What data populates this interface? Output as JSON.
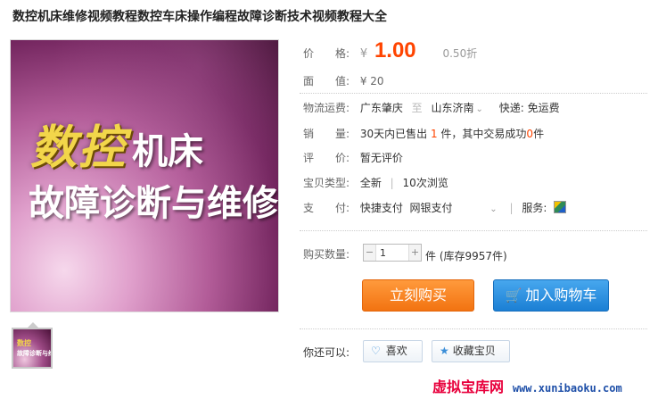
{
  "product": {
    "title": "数控机床维修视频教程数控车床操作编程故障诊断技术视频教程大全",
    "image_text_line1_gold": "数控",
    "image_text_line1_white": "机床",
    "image_text_line2": "故障诊断与维修"
  },
  "thumb": {
    "text_a": "数控",
    "text_b": "故障诊断与维修"
  },
  "price": {
    "label": "价　　格:",
    "symbol": "¥",
    "value": "1.00",
    "discount": "0.50折"
  },
  "face_value": {
    "label": "面　　值:",
    "value": "¥ 20"
  },
  "shipping": {
    "label": "物流运费:",
    "from": "广东肇庆",
    "sep": "至",
    "to": "山东济南",
    "express": "快递: 免运费"
  },
  "sales": {
    "label": "销　　量:",
    "prefix": "30天内已售出",
    "sold": "1",
    "mid": "件，其中交易成功",
    "success": "0",
    "suffix": "件"
  },
  "review": {
    "label": "评　　价:",
    "value": "暂无评价"
  },
  "item_type": {
    "label": "宝贝类型:",
    "condition": "全新",
    "views": "10次浏览"
  },
  "payment": {
    "label": "支　　付:",
    "methods": "快捷支付  网银支付",
    "service_label": "服务:"
  },
  "quantity": {
    "label": "购买数量:",
    "value": "1",
    "stock": "件 (库存9957件)"
  },
  "buttons": {
    "buy_now": "立刻购买",
    "add_cart": "加入购物车"
  },
  "also": {
    "label": "你还可以:",
    "like": "喜欢",
    "favorite": "收藏宝贝"
  },
  "watermark": {
    "cn": "虚拟宝库网",
    "url": "www.xunibaoku.com"
  },
  "colors": {
    "price": "#ff4400",
    "buy": "#f27311",
    "cart": "#1b7fd4",
    "watermark": "#e8003c"
  }
}
